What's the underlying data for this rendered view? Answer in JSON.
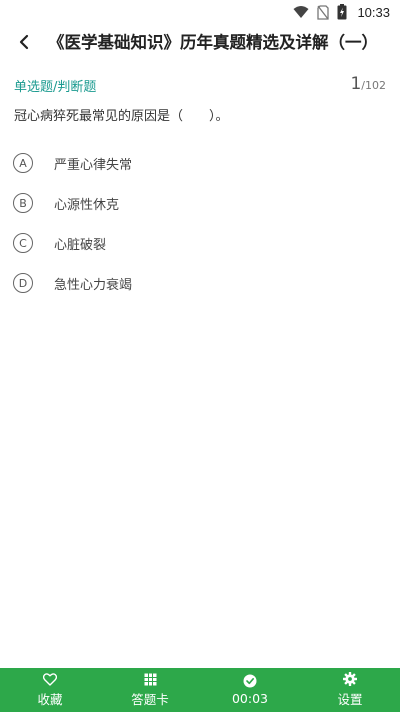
{
  "status_bar": {
    "time": "10:33"
  },
  "app_bar": {
    "title": "《医学基础知识》历年真题精选及详解（一）"
  },
  "question": {
    "type_label": "单选题/判断题",
    "current": "1",
    "total": "/102",
    "stem": "冠心病猝死最常见的原因是（　　）。",
    "options": [
      {
        "letter": "A",
        "text": "严重心律失常"
      },
      {
        "letter": "B",
        "text": "心源性休克"
      },
      {
        "letter": "C",
        "text": "心脏破裂"
      },
      {
        "letter": "D",
        "text": "急性心力衰竭"
      }
    ]
  },
  "bottom_bar": {
    "color": "#2da84a",
    "items": [
      {
        "label": "收藏",
        "icon": "heart-icon"
      },
      {
        "label": "答题卡",
        "icon": "grid-icon"
      },
      {
        "label": "00:03",
        "icon": "clock-icon"
      },
      {
        "label": "设置",
        "icon": "gear-icon"
      }
    ]
  },
  "colors": {
    "accent": "#1a9a8f",
    "bottom_bar": "#2da84a"
  }
}
